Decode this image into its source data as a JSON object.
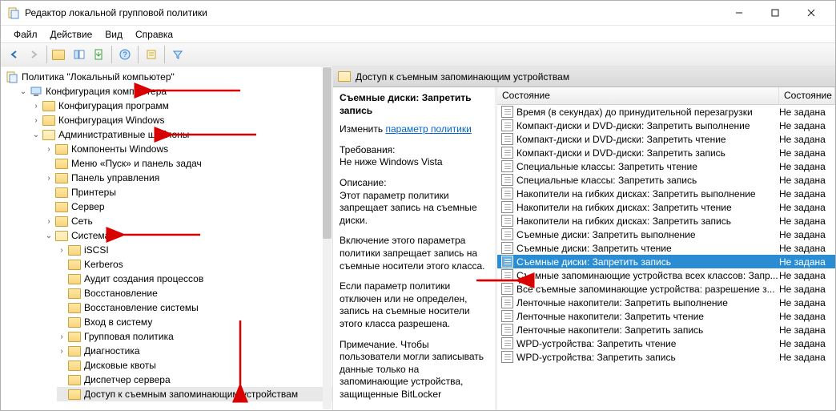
{
  "window": {
    "title": "Редактор локальной групповой политики"
  },
  "menu": {
    "file": "Файл",
    "action": "Действие",
    "view": "Вид",
    "help": "Справка"
  },
  "tree": {
    "root": "Политика \"Локальный компьютер\"",
    "computer_config": "Конфигурация компьютера",
    "software_settings": "Конфигурация программ",
    "windows_settings": "Конфигурация Windows",
    "admin_templates": "Административные шаблоны",
    "windows_components": "Компоненты Windows",
    "start_menu": "Меню «Пуск» и панель задач",
    "control_panel": "Панель управления",
    "printers": "Принтеры",
    "server": "Сервер",
    "network": "Сеть",
    "system": "Система",
    "iscsi": "iSCSI",
    "kerberos": "Kerberos",
    "process_audit": "Аудит создания процессов",
    "recovery": "Восстановление",
    "system_restore": "Восстановление системы",
    "logon": "Вход в систему",
    "group_policy": "Групповая политика",
    "diagnostics": "Диагностика",
    "disk_quotas": "Дисковые квоты",
    "server_manager": "Диспетчер сервера",
    "removable_access": "Доступ к съемным запоминающим устройствам"
  },
  "detail": {
    "breadcrumb": "Доступ к съемным запоминающим устройствам",
    "selected_title": "Съемные диски: Запретить запись",
    "edit_prefix": "Изменить",
    "edit_link": "параметр политики",
    "req_label": "Требования:",
    "req_value": "Не ниже Windows Vista",
    "desc_label": "Описание:",
    "desc_p1": "Этот параметр политики запрещает запись на съемные диски.",
    "desc_p2": "Включение этого параметра политики запрещает запись на съемные носители этого класса.",
    "desc_p3": "Если параметр политики отключен или не определен, запись на съемные носители этого класса разрешена.",
    "desc_p4": "Примечание. Чтобы пользователи могли записывать данные только на запоминающие устройства, защищенные BitLocker"
  },
  "list": {
    "col_state": "Состояние",
    "col_state2": "Состояние",
    "state_notset": "Не задана",
    "items": [
      "Время (в секундах) до принудительной перезагрузки",
      "Компакт-диски и DVD-диски: Запретить выполнение",
      "Компакт-диски и DVD-диски: Запретить чтение",
      "Компакт-диски и DVD-диски: Запретить запись",
      "Специальные классы: Запретить чтение",
      "Специальные классы: Запретить запись",
      "Накопители на гибких дисках: Запретить выполнение",
      "Накопители на гибких дисках: Запретить чтение",
      "Накопители на гибких дисках: Запретить запись",
      "Съемные диски: Запретить выполнение",
      "Съемные диски: Запретить чтение",
      "Съемные диски: Запретить запись",
      "Съемные запоминающие устройства всех классов: Запр...",
      "Все съемные запоминающие устройства: разрешение з...",
      "Ленточные накопители: Запретить выполнение",
      "Ленточные накопители: Запретить чтение",
      "Ленточные накопители: Запретить запись",
      "WPD-устройства: Запретить чтение",
      "WPD-устройства: Запретить запись"
    ],
    "selected_index": 11
  }
}
